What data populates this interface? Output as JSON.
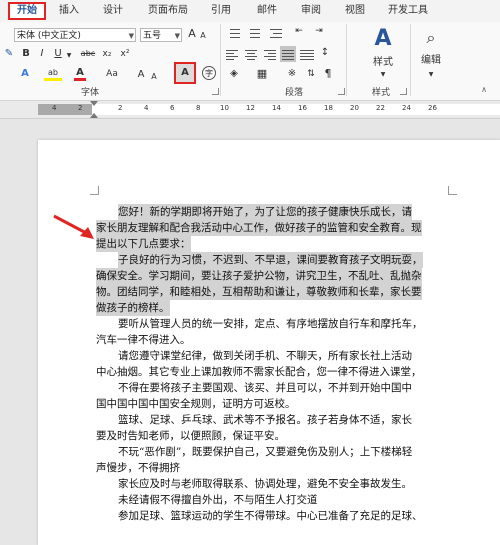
{
  "ribbon_tabs": [
    "开始",
    "插入",
    "设计",
    "页面布局",
    "引用",
    "邮件",
    "审阅",
    "视图",
    "开发工具"
  ],
  "font": {
    "name": "宋体 (中文正文)",
    "size": "五号",
    "grow": "A",
    "shrink": "A",
    "clear_label": "wén"
  },
  "format_buttons": {
    "bold": "B",
    "italic": "I",
    "underline": "U",
    "strike": "abc",
    "sub": "x₂",
    "sup": "x²",
    "font_color": "A",
    "highlight": "ab",
    "shading": "A",
    "encircle": "字",
    "aa": "Aa",
    "char_border": "A"
  },
  "groups": {
    "font": "字体",
    "paragraph": "段落",
    "styles": "样式",
    "editing": "编辑"
  },
  "styles_label": "样式",
  "editing_label": "编辑",
  "ruler_ticks": [
    "4",
    "2",
    "2",
    "4",
    "6",
    "8",
    "10",
    "12",
    "14",
    "16",
    "18",
    "20",
    "22",
    "24",
    "26"
  ],
  "document": {
    "lines": [
      {
        "text": "您好！新的学期即将开始了，为了让您的孩子健康快乐成长，请",
        "indent": true,
        "hl": true
      },
      {
        "text": "家长朋友理解和配合我活动中心工作，做好孩子的监管和安全教育。现",
        "indent": false,
        "hl": true
      },
      {
        "text": "提出以下几点要求：",
        "indent": false,
        "hl": true
      },
      {
        "text": "子良好的行为习惯，不迟到、不早退，课间要教育孩子文明玩耍，",
        "indent": true,
        "hl": true
      },
      {
        "text": "确保安全。学习期间，要让孩子爱护公物，讲究卫生，不乱吐、乱抛杂",
        "indent": false,
        "hl": true
      },
      {
        "text": "物。团结同学，和睦相处，互相帮助和谦让，尊敬教师和长辈，家长要",
        "indent": false,
        "hl": true
      },
      {
        "text": "做孩子的榜样。",
        "indent": false,
        "hl": true
      },
      {
        "text": "要听从管理人员的统一安排，定点、有序地摆放自行车和摩托车，",
        "indent": true,
        "hl": false
      },
      {
        "text": "汽车一律不得进入。",
        "indent": false,
        "hl": false
      },
      {
        "text": "请您遵守课堂纪律，做到关闭手机、不聊天，所有家长社上活动",
        "indent": true,
        "hl": false
      },
      {
        "text": "中心抽烟。其它专业上课加教师不需家长配合，您一律不得进入课堂，",
        "indent": false,
        "hl": false
      },
      {
        "text": "不得在要将孩子主要国观、该买、并且可以，不并到开始中国中",
        "indent": true,
        "hl": false
      },
      {
        "text": "国中国中国中国安全规则，证明方可返校。",
        "indent": false,
        "hl": false
      },
      {
        "text": "篮球、足球、乒乓球、武术等不予报名。孩子若身体不适，家长",
        "indent": true,
        "hl": false
      },
      {
        "text": "要及时告知老师，以便照顾，保证平安。",
        "indent": false,
        "hl": false
      },
      {
        "text": "不玩“恶作剧”，既要保护自己，又要避免伤及别人；上下楼梯轻",
        "indent": true,
        "hl": false
      },
      {
        "text": "声慢步，不得拥挤",
        "indent": false,
        "hl": false
      },
      {
        "text": "家长应及时与老师取得联系、协调处理，避免不安全事故发生。",
        "indent": true,
        "hl": false
      },
      {
        "text": "未经请假不得擅自外出，不与陌生人打交道",
        "indent": true,
        "hl": false
      },
      {
        "text": "参加足球、篮球运动的学生不得带球。中心已准备了充足的足球、",
        "indent": true,
        "hl": false
      }
    ]
  }
}
